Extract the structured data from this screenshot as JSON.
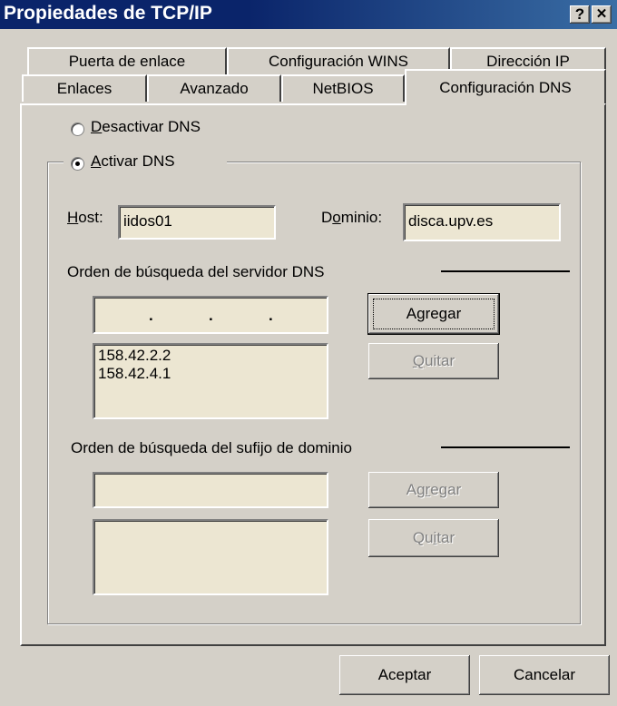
{
  "window": {
    "title": "Propiedades de TCP/IP",
    "help_button": "?",
    "close_button": "✕"
  },
  "tabs": {
    "back_row": [
      "Puerta de enlace",
      "Configuración WINS",
      "Dirección IP"
    ],
    "front_row": [
      "Enlaces",
      "Avanzado",
      "NetBIOS"
    ],
    "active": "Configuración DNS"
  },
  "dns": {
    "disable_label_u": "D",
    "disable_label_rest": "esactivar DNS",
    "enable_label_u": "A",
    "enable_label_rest": "ctivar DNS",
    "enable_selected": true,
    "host_label_u": "H",
    "host_label_rest": "ost:",
    "host_value": "iidos01",
    "domain_label_pre": "D",
    "domain_label_u": "o",
    "domain_label_rest": "minio:",
    "domain_value": "disca.upv.es",
    "server_order_label": "Orden de búsqueda del servidor DNS",
    "ip_dots": [
      ".",
      ".",
      "."
    ],
    "server_list": [
      "158.42.2.2",
      "158.42.4.1"
    ],
    "add_button_pre": "A",
    "add_button_u": "g",
    "add_button_rest": "regar",
    "remove_button_u": "Q",
    "remove_button_rest": "uitar",
    "suffix_order_label": "Orden de búsqueda del sufijo de dominio",
    "suffix_add_pre": "Ag",
    "suffix_add_u": "r",
    "suffix_add_rest": "egar",
    "suffix_remove_pre": "Qu",
    "suffix_remove_u": "i",
    "suffix_remove_rest": "tar"
  },
  "footer": {
    "ok_button": "Aceptar",
    "cancel_button": "Cancelar"
  }
}
